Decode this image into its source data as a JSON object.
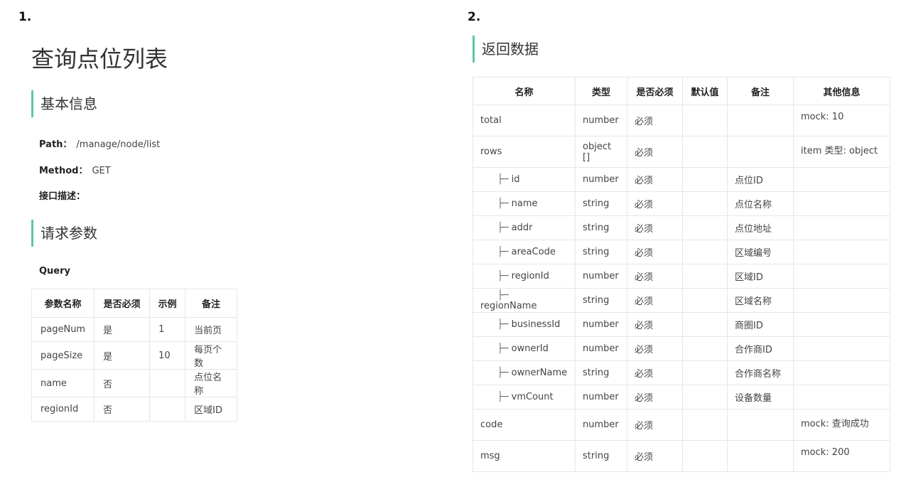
{
  "left": {
    "num": "1.",
    "title": "查询点位列表",
    "basic_info": {
      "heading": "基本信息",
      "path_label": "Path：",
      "path_value": "/manage/node/list",
      "method_label": "Method：",
      "method_value": "GET",
      "desc_label": "接口描述："
    },
    "request": {
      "heading": "请求参数",
      "query_label": "Query",
      "headers": [
        "参数名称",
        "是否必须",
        "示例",
        "备注"
      ],
      "rows": [
        [
          "pageNum",
          "是",
          "1",
          "当前页"
        ],
        [
          "pageSize",
          "是",
          "10",
          "每页个数"
        ],
        [
          "name",
          "否",
          "",
          "点位名称"
        ],
        [
          "regionId",
          "否",
          "",
          "区域ID"
        ]
      ]
    }
  },
  "right": {
    "num": "2.",
    "heading": "返回数据",
    "headers": [
      "名称",
      "类型",
      "是否必须",
      "默认值",
      "备注",
      "其他信息"
    ],
    "rows": [
      {
        "name": "total",
        "type": "number",
        "req": "必须",
        "default": "",
        "note": "",
        "other": "mock: 10",
        "child": false
      },
      {
        "name": "rows",
        "type": "object []",
        "req": "必须",
        "default": "",
        "note": "",
        "other": "item 类型: object",
        "child": false
      },
      {
        "name": "id",
        "type": "number",
        "req": "必须",
        "default": "",
        "note": "点位ID",
        "other": "",
        "child": true
      },
      {
        "name": "name",
        "type": "string",
        "req": "必须",
        "default": "",
        "note": "点位名称",
        "other": "",
        "child": true
      },
      {
        "name": "addr",
        "type": "string",
        "req": "必须",
        "default": "",
        "note": "点位地址",
        "other": "",
        "child": true
      },
      {
        "name": "areaCode",
        "type": "string",
        "req": "必须",
        "default": "",
        "note": "区域编号",
        "other": "",
        "child": true
      },
      {
        "name": "regionId",
        "type": "number",
        "req": "必须",
        "default": "",
        "note": "区域ID",
        "other": "",
        "child": true
      },
      {
        "name": "regionName",
        "type": "string",
        "req": "必须",
        "default": "",
        "note": "区域名称",
        "other": "",
        "child": true
      },
      {
        "name": "businessId",
        "type": "number",
        "req": "必须",
        "default": "",
        "note": "商圈ID",
        "other": "",
        "child": true
      },
      {
        "name": "ownerId",
        "type": "number",
        "req": "必须",
        "default": "",
        "note": "合作商ID",
        "other": "",
        "child": true
      },
      {
        "name": "ownerName",
        "type": "string",
        "req": "必须",
        "default": "",
        "note": "合作商名称",
        "other": "",
        "child": true
      },
      {
        "name": "vmCount",
        "type": "number",
        "req": "必须",
        "default": "",
        "note": "设备数量",
        "other": "",
        "child": true
      },
      {
        "name": "code",
        "type": "number",
        "req": "必须",
        "default": "",
        "note": "",
        "other": "mock: 查询成功",
        "child": false
      },
      {
        "name": "msg",
        "type": "string",
        "req": "必须",
        "default": "",
        "note": "",
        "other": "mock: 200",
        "child": false
      }
    ],
    "tree_glyph": "├─"
  },
  "colors": {
    "accent_bar": "#5cc8a0",
    "border": "#e6e6e6"
  }
}
